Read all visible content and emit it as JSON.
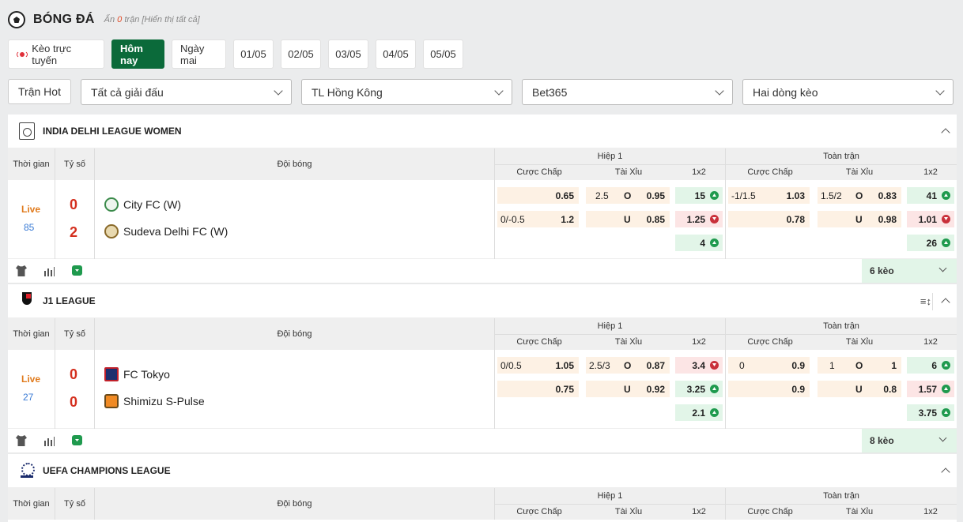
{
  "header": {
    "title": "BÓNG ĐÁ",
    "hidden_prefix": "Ẩn ",
    "hidden_count": "0",
    "hidden_suffix": " trận [Hiển thị tất cả]"
  },
  "tabs": [
    {
      "label": "Kèo trực tuyến"
    },
    {
      "label": "Hôm nay"
    },
    {
      "label": "Ngày mai"
    },
    {
      "label": "01/05"
    },
    {
      "label": "02/05"
    },
    {
      "label": "03/05"
    },
    {
      "label": "04/05"
    },
    {
      "label": "05/05"
    }
  ],
  "filters": {
    "hot": "Trận Hot",
    "league": "Tất cả giải đấu",
    "odds_type": "TL Hồng Kông",
    "bookmaker": "Bet365",
    "lines": "Hai dòng kèo"
  },
  "columns": {
    "time": "Thời gian",
    "score": "Tỷ số",
    "teams": "Đội bóng",
    "half": "Hiệp 1",
    "full": "Toàn trận",
    "handicap": "Cược Chấp",
    "ou": "Tài Xỉu",
    "x12": "1x2"
  },
  "leagues": [
    {
      "name": "INDIA DELHI LEAGUE WOMEN",
      "status": "Live",
      "minute": "85",
      "score_home": "0",
      "score_away": "2",
      "home": "City FC (W)",
      "away": "Sudeva Delhi FC (W)",
      "h1": {
        "hc": [
          [
            "",
            "0.65"
          ],
          [
            "0/-0.5",
            "1.2"
          ]
        ],
        "ou": [
          [
            "2.5",
            "O",
            "0.95"
          ],
          [
            "",
            "U",
            "0.85"
          ]
        ],
        "x12": [
          "15",
          "1.25",
          "4"
        ]
      },
      "ft": {
        "hc": [
          [
            "-1/1.5",
            "1.03"
          ],
          [
            "",
            "0.78"
          ]
        ],
        "ou": [
          [
            "1.5/2",
            "O",
            "0.83"
          ],
          [
            "",
            "U",
            "0.98"
          ]
        ],
        "x12": [
          "41",
          "1.01",
          "26"
        ]
      },
      "more": "6 kèo"
    },
    {
      "name": "J1 LEAGUE",
      "status": "Live",
      "minute": "27",
      "score_home": "0",
      "score_away": "0",
      "home": "FC Tokyo",
      "away": "Shimizu S-Pulse",
      "h1": {
        "hc": [
          [
            "0/0.5",
            "1.05"
          ],
          [
            "",
            "0.75"
          ]
        ],
        "ou": [
          [
            "2.5/3",
            "O",
            "0.87"
          ],
          [
            "",
            "U",
            "0.92"
          ]
        ],
        "x12": [
          "3.4",
          "3.25",
          "2.1"
        ]
      },
      "ft": {
        "hc": [
          [
            "0",
            "0.9"
          ],
          [
            "",
            "0.9"
          ]
        ],
        "ou": [
          [
            "1",
            "O",
            "1"
          ],
          [
            "",
            "U",
            "0.8"
          ]
        ],
        "x12": [
          "6",
          "1.57",
          "3.75"
        ]
      },
      "more": "8 kèo"
    },
    {
      "name": "UEFA CHAMPIONS LEAGUE"
    }
  ],
  "colors": {
    "accent": "#0b6a3a",
    "live": "#e07a1c",
    "score": "#d4301f",
    "minute": "#3a7bd5"
  }
}
